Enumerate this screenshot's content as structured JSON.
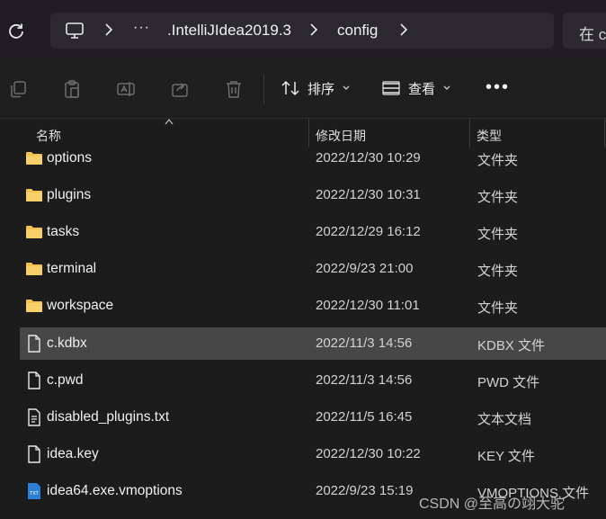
{
  "address": {
    "crumbs": [
      ".IntelliJIdea2019.3",
      "config"
    ],
    "overflow": "···",
    "search_placeholder": "在 c"
  },
  "toolbar": {
    "sort_label": "排序",
    "view_label": "查看",
    "more_label": "•••"
  },
  "columns": {
    "name": "名称",
    "date": "修改日期",
    "type": "类型"
  },
  "files": [
    {
      "name": "options",
      "date": "2022/12/30 10:29",
      "type": "文件夹",
      "icon": "folder-icon"
    },
    {
      "name": "plugins",
      "date": "2022/12/30 10:31",
      "type": "文件夹",
      "icon": "folder-icon"
    },
    {
      "name": "tasks",
      "date": "2022/12/29 16:12",
      "type": "文件夹",
      "icon": "folder-icon"
    },
    {
      "name": "terminal",
      "date": "2022/9/23 21:00",
      "type": "文件夹",
      "icon": "folder-icon"
    },
    {
      "name": "workspace",
      "date": "2022/12/30 11:01",
      "type": "文件夹",
      "icon": "folder-icon"
    },
    {
      "name": "c.kdbx",
      "date": "2022/11/3 14:56",
      "type": "KDBX 文件",
      "icon": "file-icon",
      "selected": true
    },
    {
      "name": "c.pwd",
      "date": "2022/11/3 14:56",
      "type": "PWD 文件",
      "icon": "file-icon"
    },
    {
      "name": "disabled_plugins.txt",
      "date": "2022/11/5 16:45",
      "type": "文本文档",
      "icon": "text-file-icon"
    },
    {
      "name": "idea.key",
      "date": "2022/12/30 10:22",
      "type": "KEY 文件",
      "icon": "file-icon"
    },
    {
      "name": "idea64.exe.vmoptions",
      "date": "2022/9/23 15:19",
      "type": "VMOPTIONS 文件",
      "icon": "txt-blue-icon"
    }
  ],
  "watermark": "CSDN @至高の翊大驼",
  "colors": {
    "folder": "#f2c24b",
    "selected_row": "#474747",
    "background": "#1c1c1c"
  }
}
